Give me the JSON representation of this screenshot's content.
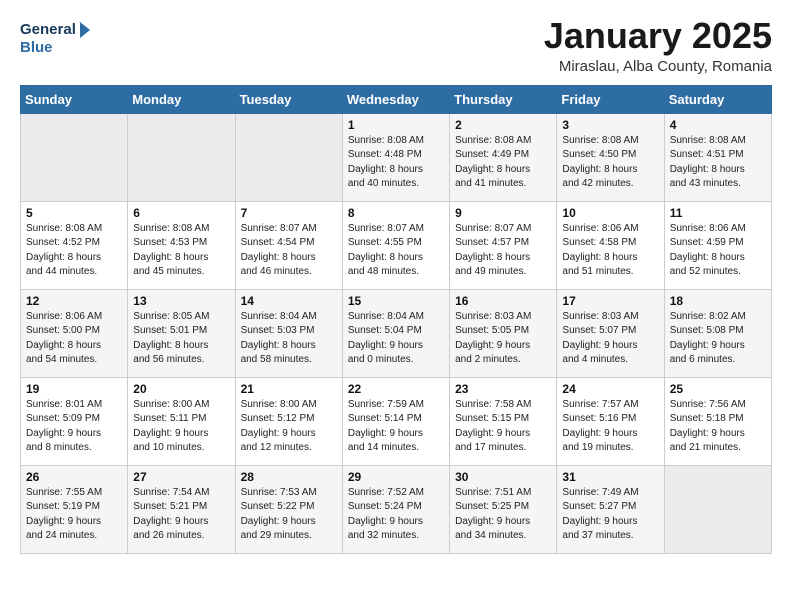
{
  "header": {
    "logo_line1": "General",
    "logo_line2": "Blue",
    "title": "January 2025",
    "subtitle": "Miraslau, Alba County, Romania"
  },
  "weekdays": [
    "Sunday",
    "Monday",
    "Tuesday",
    "Wednesday",
    "Thursday",
    "Friday",
    "Saturday"
  ],
  "weeks": [
    [
      {
        "day": "",
        "info": ""
      },
      {
        "day": "",
        "info": ""
      },
      {
        "day": "",
        "info": ""
      },
      {
        "day": "1",
        "info": "Sunrise: 8:08 AM\nSunset: 4:48 PM\nDaylight: 8 hours\nand 40 minutes."
      },
      {
        "day": "2",
        "info": "Sunrise: 8:08 AM\nSunset: 4:49 PM\nDaylight: 8 hours\nand 41 minutes."
      },
      {
        "day": "3",
        "info": "Sunrise: 8:08 AM\nSunset: 4:50 PM\nDaylight: 8 hours\nand 42 minutes."
      },
      {
        "day": "4",
        "info": "Sunrise: 8:08 AM\nSunset: 4:51 PM\nDaylight: 8 hours\nand 43 minutes."
      }
    ],
    [
      {
        "day": "5",
        "info": "Sunrise: 8:08 AM\nSunset: 4:52 PM\nDaylight: 8 hours\nand 44 minutes."
      },
      {
        "day": "6",
        "info": "Sunrise: 8:08 AM\nSunset: 4:53 PM\nDaylight: 8 hours\nand 45 minutes."
      },
      {
        "day": "7",
        "info": "Sunrise: 8:07 AM\nSunset: 4:54 PM\nDaylight: 8 hours\nand 46 minutes."
      },
      {
        "day": "8",
        "info": "Sunrise: 8:07 AM\nSunset: 4:55 PM\nDaylight: 8 hours\nand 48 minutes."
      },
      {
        "day": "9",
        "info": "Sunrise: 8:07 AM\nSunset: 4:57 PM\nDaylight: 8 hours\nand 49 minutes."
      },
      {
        "day": "10",
        "info": "Sunrise: 8:06 AM\nSunset: 4:58 PM\nDaylight: 8 hours\nand 51 minutes."
      },
      {
        "day": "11",
        "info": "Sunrise: 8:06 AM\nSunset: 4:59 PM\nDaylight: 8 hours\nand 52 minutes."
      }
    ],
    [
      {
        "day": "12",
        "info": "Sunrise: 8:06 AM\nSunset: 5:00 PM\nDaylight: 8 hours\nand 54 minutes."
      },
      {
        "day": "13",
        "info": "Sunrise: 8:05 AM\nSunset: 5:01 PM\nDaylight: 8 hours\nand 56 minutes."
      },
      {
        "day": "14",
        "info": "Sunrise: 8:04 AM\nSunset: 5:03 PM\nDaylight: 8 hours\nand 58 minutes."
      },
      {
        "day": "15",
        "info": "Sunrise: 8:04 AM\nSunset: 5:04 PM\nDaylight: 9 hours\nand 0 minutes."
      },
      {
        "day": "16",
        "info": "Sunrise: 8:03 AM\nSunset: 5:05 PM\nDaylight: 9 hours\nand 2 minutes."
      },
      {
        "day": "17",
        "info": "Sunrise: 8:03 AM\nSunset: 5:07 PM\nDaylight: 9 hours\nand 4 minutes."
      },
      {
        "day": "18",
        "info": "Sunrise: 8:02 AM\nSunset: 5:08 PM\nDaylight: 9 hours\nand 6 minutes."
      }
    ],
    [
      {
        "day": "19",
        "info": "Sunrise: 8:01 AM\nSunset: 5:09 PM\nDaylight: 9 hours\nand 8 minutes."
      },
      {
        "day": "20",
        "info": "Sunrise: 8:00 AM\nSunset: 5:11 PM\nDaylight: 9 hours\nand 10 minutes."
      },
      {
        "day": "21",
        "info": "Sunrise: 8:00 AM\nSunset: 5:12 PM\nDaylight: 9 hours\nand 12 minutes."
      },
      {
        "day": "22",
        "info": "Sunrise: 7:59 AM\nSunset: 5:14 PM\nDaylight: 9 hours\nand 14 minutes."
      },
      {
        "day": "23",
        "info": "Sunrise: 7:58 AM\nSunset: 5:15 PM\nDaylight: 9 hours\nand 17 minutes."
      },
      {
        "day": "24",
        "info": "Sunrise: 7:57 AM\nSunset: 5:16 PM\nDaylight: 9 hours\nand 19 minutes."
      },
      {
        "day": "25",
        "info": "Sunrise: 7:56 AM\nSunset: 5:18 PM\nDaylight: 9 hours\nand 21 minutes."
      }
    ],
    [
      {
        "day": "26",
        "info": "Sunrise: 7:55 AM\nSunset: 5:19 PM\nDaylight: 9 hours\nand 24 minutes."
      },
      {
        "day": "27",
        "info": "Sunrise: 7:54 AM\nSunset: 5:21 PM\nDaylight: 9 hours\nand 26 minutes."
      },
      {
        "day": "28",
        "info": "Sunrise: 7:53 AM\nSunset: 5:22 PM\nDaylight: 9 hours\nand 29 minutes."
      },
      {
        "day": "29",
        "info": "Sunrise: 7:52 AM\nSunset: 5:24 PM\nDaylight: 9 hours\nand 32 minutes."
      },
      {
        "day": "30",
        "info": "Sunrise: 7:51 AM\nSunset: 5:25 PM\nDaylight: 9 hours\nand 34 minutes."
      },
      {
        "day": "31",
        "info": "Sunrise: 7:49 AM\nSunset: 5:27 PM\nDaylight: 9 hours\nand 37 minutes."
      },
      {
        "day": "",
        "info": ""
      }
    ]
  ]
}
